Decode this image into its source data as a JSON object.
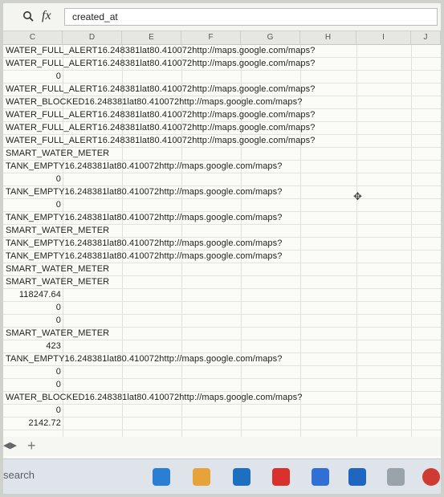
{
  "formula_bar": {
    "search_icon": "search-icon",
    "fx_label": "fx",
    "value": "created_at"
  },
  "columns": [
    "C",
    "D",
    "E",
    "F",
    "G",
    "H",
    "I",
    "J"
  ],
  "rows": [
    {
      "text": "WATER_FULL_ALERT16.248381lat80.410072http://maps.google.com/maps?",
      "align": "left"
    },
    {
      "text": "WATER_FULL_ALERT16.248381lat80.410072http://maps.google.com/maps?",
      "align": "left"
    },
    {
      "text": "0",
      "align": "right"
    },
    {
      "text": "WATER_FULL_ALERT16.248381lat80.410072http://maps.google.com/maps?",
      "align": "left"
    },
    {
      "text": "WATER_BLOCKED16.248381lat80.410072http://maps.google.com/maps?",
      "align": "left"
    },
    {
      "text": "WATER_FULL_ALERT16.248381lat80.410072http://maps.google.com/maps?",
      "align": "left"
    },
    {
      "text": "WATER_FULL_ALERT16.248381lat80.410072http://maps.google.com/maps?",
      "align": "left"
    },
    {
      "text": "WATER_FULL_ALERT16.248381lat80.410072http://maps.google.com/maps?",
      "align": "left"
    },
    {
      "text": "SMART_WATER_METER",
      "align": "left"
    },
    {
      "text": "TANK_EMPTY16.248381lat80.410072http://maps.google.com/maps?",
      "align": "left"
    },
    {
      "text": "0",
      "align": "right"
    },
    {
      "text": "TANK_EMPTY16.248381lat80.410072http://maps.google.com/maps?",
      "align": "left"
    },
    {
      "text": "0",
      "align": "right"
    },
    {
      "text": "TANK_EMPTY16.248381lat80.410072http://maps.google.com/maps?",
      "align": "left"
    },
    {
      "text": "SMART_WATER_METER",
      "align": "left"
    },
    {
      "text": "TANK_EMPTY16.248381lat80.410072http://maps.google.com/maps?",
      "align": "left"
    },
    {
      "text": "TANK_EMPTY16.248381lat80.410072http://maps.google.com/maps?",
      "align": "left"
    },
    {
      "text": "SMART_WATER_METER",
      "align": "left"
    },
    {
      "text": "SMART_WATER_METER",
      "align": "left"
    },
    {
      "text": "118247.64",
      "align": "right"
    },
    {
      "text": "0",
      "align": "right"
    },
    {
      "text": "0",
      "align": "right"
    },
    {
      "text": "SMART_WATER_METER",
      "align": "left"
    },
    {
      "text": "423",
      "align": "right"
    },
    {
      "text": "TANK_EMPTY16.248381lat80.410072http://maps.google.com/maps?",
      "align": "left"
    },
    {
      "text": "0",
      "align": "right"
    },
    {
      "text": "0",
      "align": "right"
    },
    {
      "text": "WATER_BLOCKED16.248381lat80.410072http://maps.google.com/maps?",
      "align": "left"
    },
    {
      "text": "0",
      "align": "right"
    },
    {
      "text": "2142.72",
      "align": "right"
    }
  ],
  "sheet_bar": {
    "nav_icon": "sheet-nav-icon",
    "add_label": "+"
  },
  "taskbar": {
    "search_label": "search",
    "icon_colors": [
      "#2a7fd4",
      "#e8a23a",
      "#1d6fbf",
      "#d9312b",
      "#2f6fd6",
      "#1f66c1",
      "#9aa2aa",
      "#cf3a33"
    ]
  }
}
